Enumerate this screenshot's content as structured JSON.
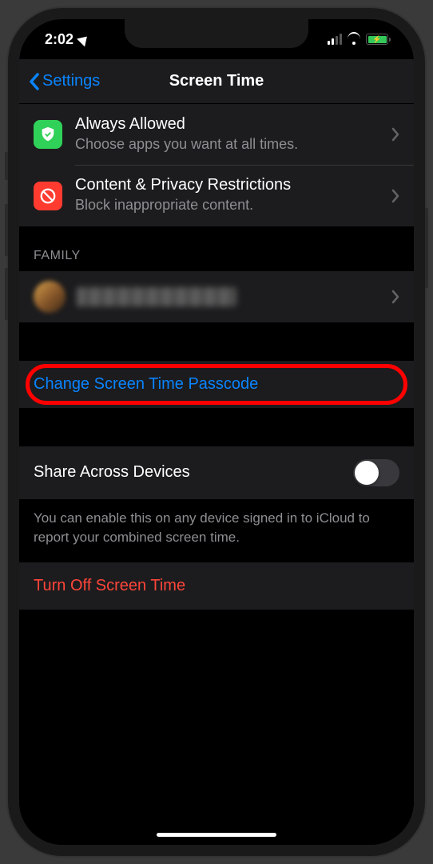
{
  "statusBar": {
    "time": "2:02"
  },
  "nav": {
    "backLabel": "Settings",
    "title": "Screen Time"
  },
  "rows": {
    "alwaysAllowed": {
      "title": "Always Allowed",
      "subtitle": "Choose apps you want at all times."
    },
    "contentPrivacy": {
      "title": "Content & Privacy Restrictions",
      "subtitle": "Block inappropriate content."
    }
  },
  "sections": {
    "familyHeader": "FAMILY"
  },
  "actions": {
    "changePasscode": "Change Screen Time Passcode",
    "shareAcross": "Share Across Devices",
    "shareFooter": "You can enable this on any device signed in to iCloud to report your combined screen time.",
    "turnOff": "Turn Off Screen Time"
  }
}
